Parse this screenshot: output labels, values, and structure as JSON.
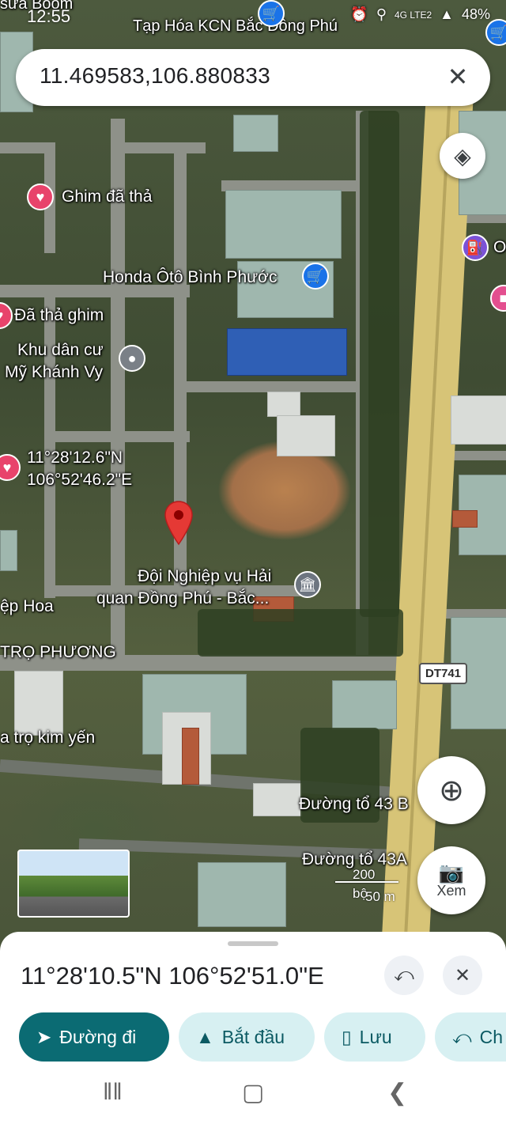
{
  "status_bar": {
    "time": "12:55",
    "battery": "48%",
    "network": "4G LTE2"
  },
  "search": {
    "query": "11.469583,106.880833"
  },
  "map": {
    "labels": {
      "top_partial_left": "sửa Boom",
      "top_store": "Tạp Hóa KCN Bắc Đồng Phú",
      "pin1": "Ghim đã thả",
      "honda": "Honda Ôtô Bình Phước",
      "pin2": "Đã thả ghim",
      "residence_line1": "Khu dân cư",
      "residence_line2": "Mỹ Khánh Vy",
      "pin3_lat": "11°28'12.6\"N",
      "pin3_lng": "106°52'46.2\"E",
      "customs_line1": "Đội Nghiệp vụ Hải",
      "customs_line2": "quan Đồng Phú -  Bắc...",
      "left_hoa": "ệp Hoa",
      "tro_phuong": "TRỌ PHƯƠNG",
      "kim_yen": "a trọ kim yến",
      "road_43b": "Đường tổ 43 B",
      "road_43a": "Đường tổ 43A",
      "right_edge": "O"
    },
    "road_shield": "DT741",
    "scale": {
      "imperial": "200 bộ",
      "metric": "50 m"
    }
  },
  "buttons": {
    "xem": "Xem"
  },
  "sheet": {
    "coordinates": "11°28'10.5\"N 106°52'51.0\"E",
    "chips": {
      "directions": "Đường đi",
      "start": "Bắt đầu",
      "save": "Lưu",
      "share": "Ch"
    }
  },
  "colors": {
    "primary_chip": "#0b6b73",
    "secondary_chip": "#d7f0f2",
    "marker_red": "#e53935",
    "highway": "#d7c477"
  }
}
